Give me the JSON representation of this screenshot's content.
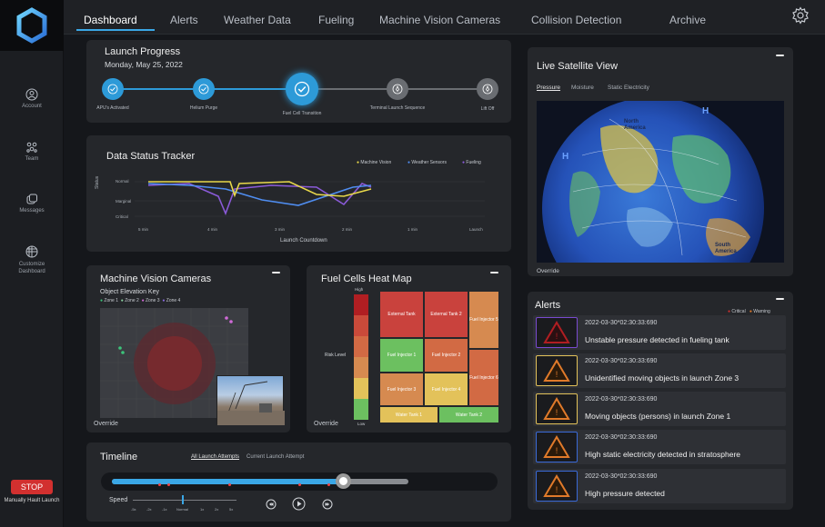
{
  "sidebar": {
    "items": [
      {
        "label": "Account",
        "icon": "account-icon"
      },
      {
        "label": "Team",
        "icon": "team-icon"
      },
      {
        "label": "Messages",
        "icon": "messages-icon"
      },
      {
        "label": "Customize Dashboard",
        "icon": "grid-icon"
      }
    ],
    "stop_label": "STOP",
    "halt_label": "Manually Hault Launch"
  },
  "nav": {
    "tabs": [
      "Dashboard",
      "Alerts",
      "Weather Data",
      "Fueling",
      "Machine Vision Cameras",
      "Collision Detection",
      "Archive"
    ],
    "active": "Dashboard"
  },
  "launch_progress": {
    "title": "Launch Progress",
    "date": "Monday, May 25, 2022",
    "steps": [
      "APU's Activated",
      "Helium Purge",
      "Fuel Cell Transition",
      "Terminal Launch Sequence",
      "Lift Off"
    ]
  },
  "data_status": {
    "title": "Data Status Tracker",
    "legend": [
      "Machine Vision",
      "Weather Sensors",
      "Fueling"
    ],
    "y_axis_title": "Status",
    "y_ticks": [
      "Normal",
      "Marginal",
      "Critical"
    ],
    "x_ticks": [
      "5 min",
      "4 min",
      "3 min",
      "2 min",
      "1 min",
      "Launch"
    ],
    "x_axis_title": "Launch Countdown",
    "colors": {
      "machine_vision": "#e8d84a",
      "weather": "#4f8df0",
      "fueling": "#8a5ad8"
    }
  },
  "satellite": {
    "title": "Live Satellite View",
    "tabs": [
      "Pressure",
      "Moisture",
      "Static Electricity"
    ],
    "labels": [
      "North America",
      "South America",
      "H",
      "H"
    ],
    "override": "Override"
  },
  "machine_vision": {
    "title": "Machine Vision Cameras",
    "subtitle": "Object Elevation Key",
    "zones": [
      "Zone 1",
      "Zone 2",
      "Zone 3",
      "Zone 4"
    ],
    "zone_colors": [
      "#3cc47a",
      "#8ad0a0",
      "#d06ad8",
      "#8a6ae0"
    ],
    "override": "Override"
  },
  "heatmap": {
    "title": "Fuel Cells Heat Map",
    "risk_label": "Risk Level",
    "scale_high": "High",
    "scale_low": "Low",
    "cells": [
      "External Tank",
      "External Tank 2",
      "Fuel Injector 5",
      "Fuel Injector 1",
      "Fuel Injector 2",
      "Fuel Injector 3",
      "Fuel Injector 4",
      "Fuel Injector 6",
      "Water Tank 1",
      "Water Tank 2"
    ],
    "override": "Override"
  },
  "timeline": {
    "title": "Timeline",
    "tabs": [
      "All Launch Attempts",
      "Current Launch Attempt"
    ],
    "progress": 0.78,
    "speed_label": "Speed",
    "speeds": [
      "-5x",
      "-2x",
      "-1x",
      "Normal",
      "1x",
      "2x",
      "5x"
    ]
  },
  "alerts": {
    "title": "Alerts",
    "legend": [
      "Critical",
      "Warning"
    ],
    "rows": [
      {
        "time": "2022-03-30*02:30:33:690",
        "message": "Unstable pressure detected in fueling tank",
        "level": "critical"
      },
      {
        "time": "2022-03-30*02:30:33:690",
        "message": "Unidentified moving objects in launch Zone 3",
        "level": "warning"
      },
      {
        "time": "2022-03-30*02:30:33:690",
        "message": "Moving objects (persons) in launch Zone 1",
        "level": "warning"
      },
      {
        "time": "2022-03-30*02:30:33:690",
        "message": "High static electricity detected in stratosphere",
        "level": "info"
      },
      {
        "time": "2022-03-30*02:30:33:690",
        "message": "High pressure detected",
        "level": "info"
      }
    ]
  }
}
